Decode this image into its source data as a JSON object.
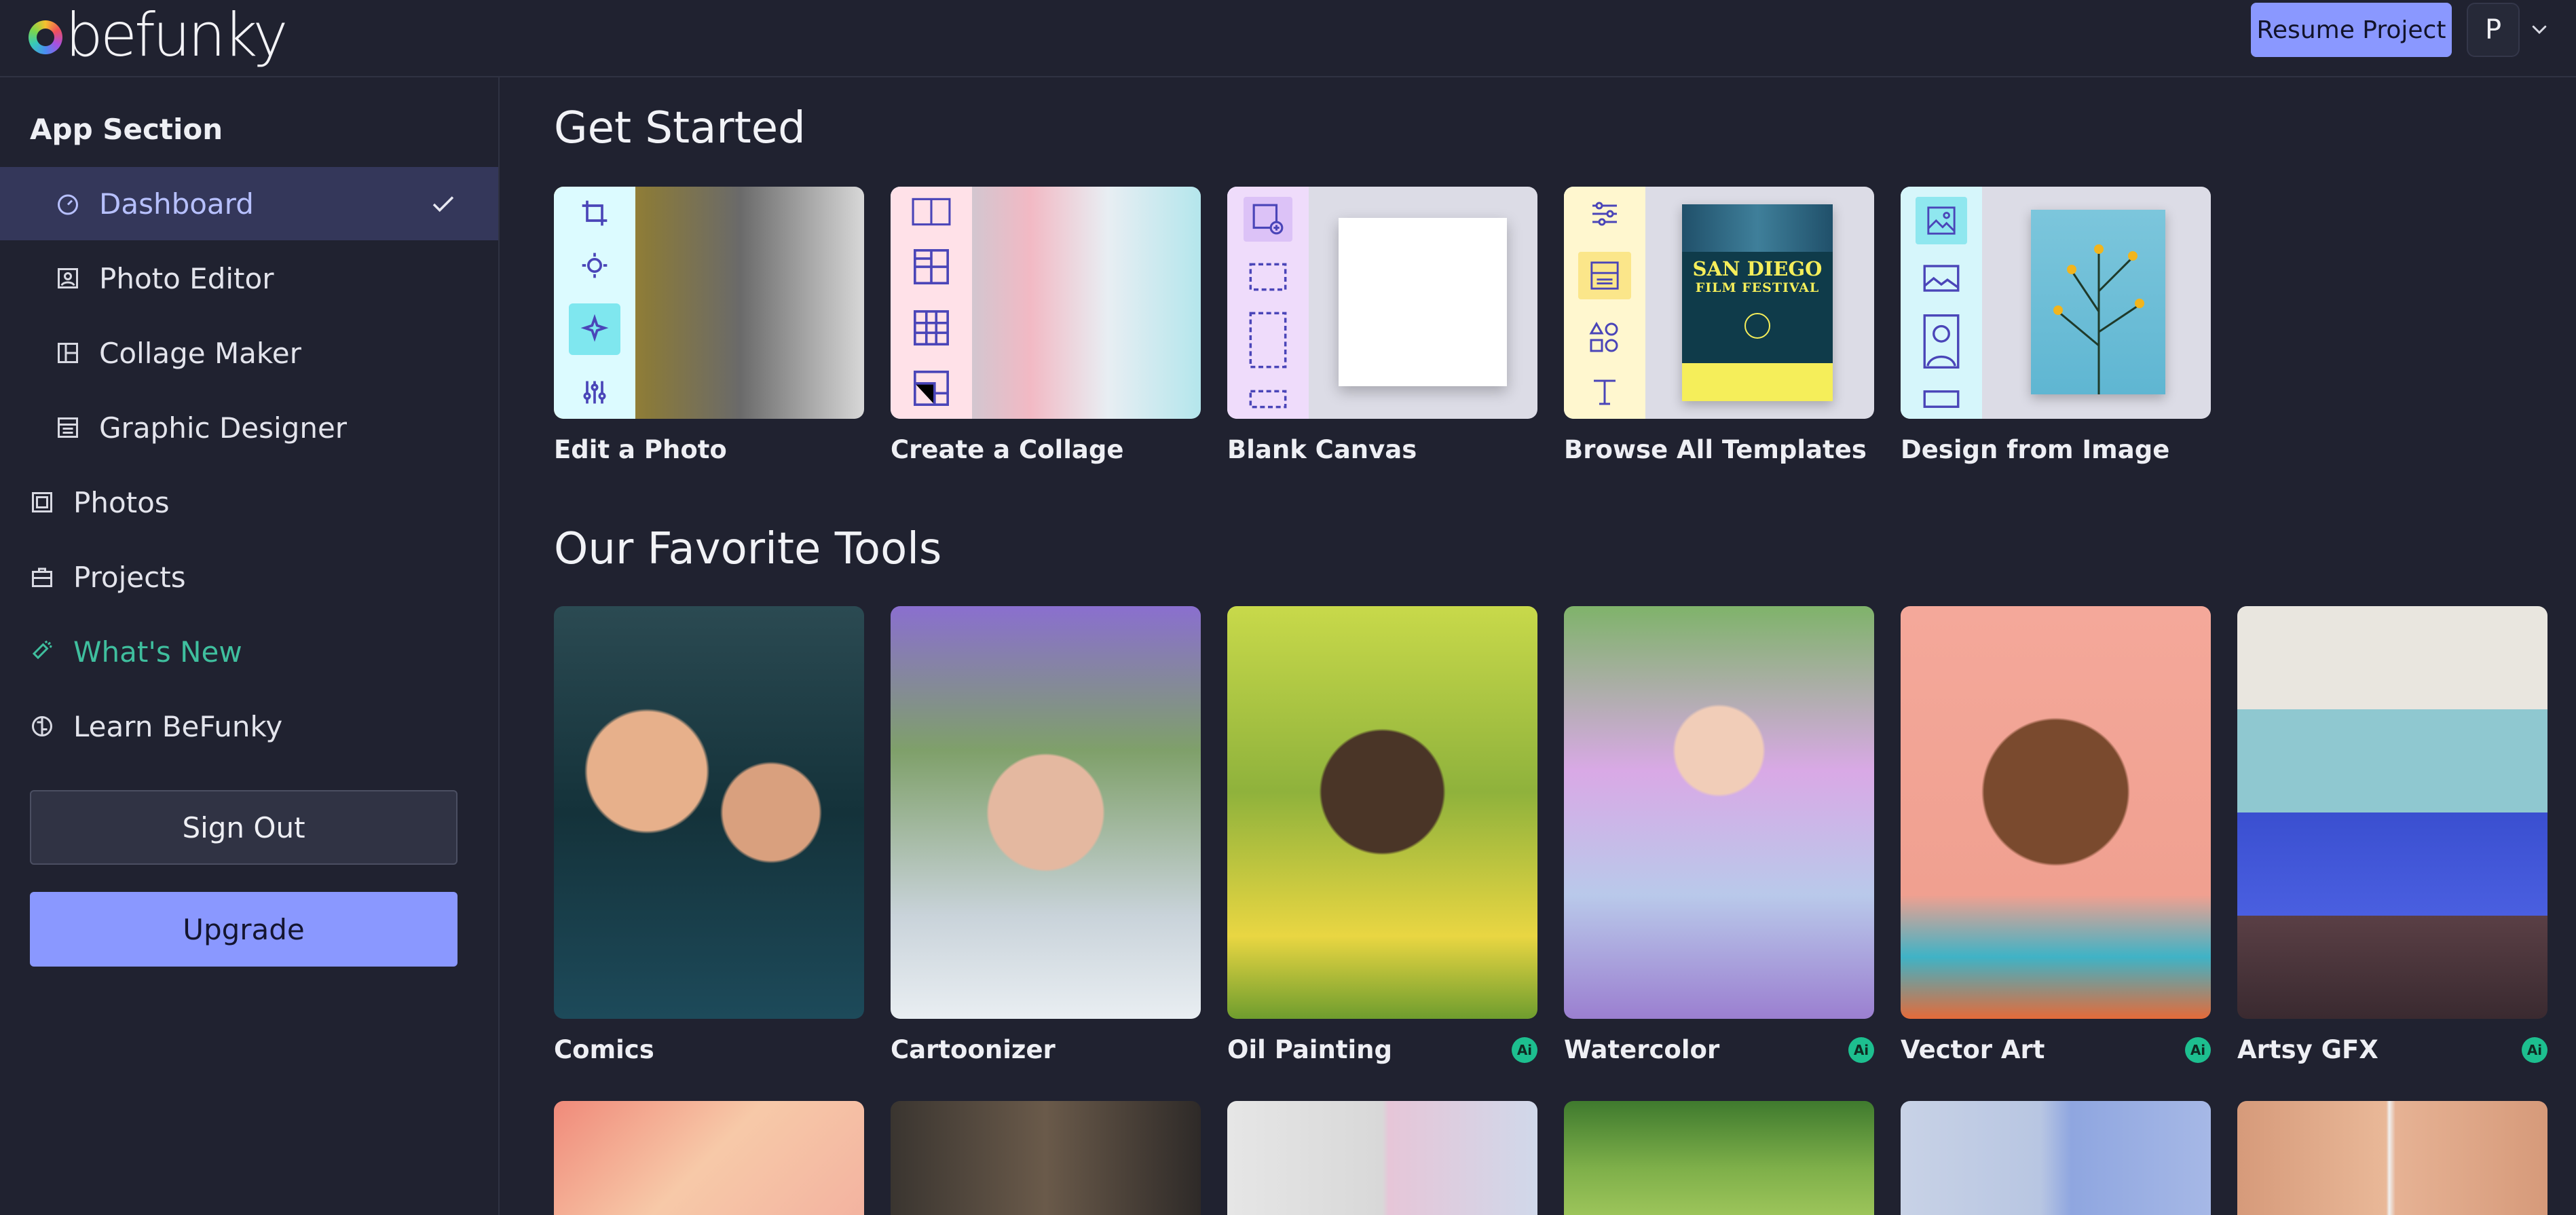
{
  "header": {
    "logo_text": "befunky",
    "resume_label": "Resume Project",
    "avatar_initial": "P"
  },
  "sidebar": {
    "section_title": "App Section",
    "items": [
      {
        "label": "Dashboard",
        "icon": "gauge-icon",
        "active": true
      },
      {
        "label": "Photo Editor",
        "icon": "image-icon"
      },
      {
        "label": "Collage Maker",
        "icon": "layout-icon"
      },
      {
        "label": "Graphic Designer",
        "icon": "template-icon"
      },
      {
        "label": "Photos",
        "icon": "photo-frame-icon"
      },
      {
        "label": "Projects",
        "icon": "briefcase-icon"
      },
      {
        "label": "What's New",
        "icon": "megaphone-icon"
      },
      {
        "label": "Learn BeFunky",
        "icon": "brain-icon"
      }
    ],
    "sign_out_label": "Sign Out",
    "upgrade_label": "Upgrade"
  },
  "get_started": {
    "title": "Get Started",
    "cards": [
      {
        "label": "Edit a Photo"
      },
      {
        "label": "Create a Collage"
      },
      {
        "label": "Blank Canvas"
      },
      {
        "label": "Browse All Templates"
      },
      {
        "label": "Design from Image"
      }
    ],
    "poster": {
      "line1": "SAN DIEGO",
      "line2": "FILM FESTIVAL"
    }
  },
  "favorite_tools": {
    "title": "Our Favorite Tools",
    "cards": [
      {
        "label": "Comics",
        "ai": false
      },
      {
        "label": "Cartoonizer",
        "ai": false
      },
      {
        "label": "Oil Painting",
        "ai": true
      },
      {
        "label": "Watercolor",
        "ai": true
      },
      {
        "label": "Vector Art",
        "ai": true
      },
      {
        "label": "Artsy GFX",
        "ai": true
      }
    ],
    "ai_badge_text": "Ai"
  },
  "colors": {
    "background": "#202230",
    "accent": "#8a98ff",
    "active_nav": "#34375a",
    "whats_new": "#3fbf9e",
    "ai_badge": "#1dbf8f"
  }
}
